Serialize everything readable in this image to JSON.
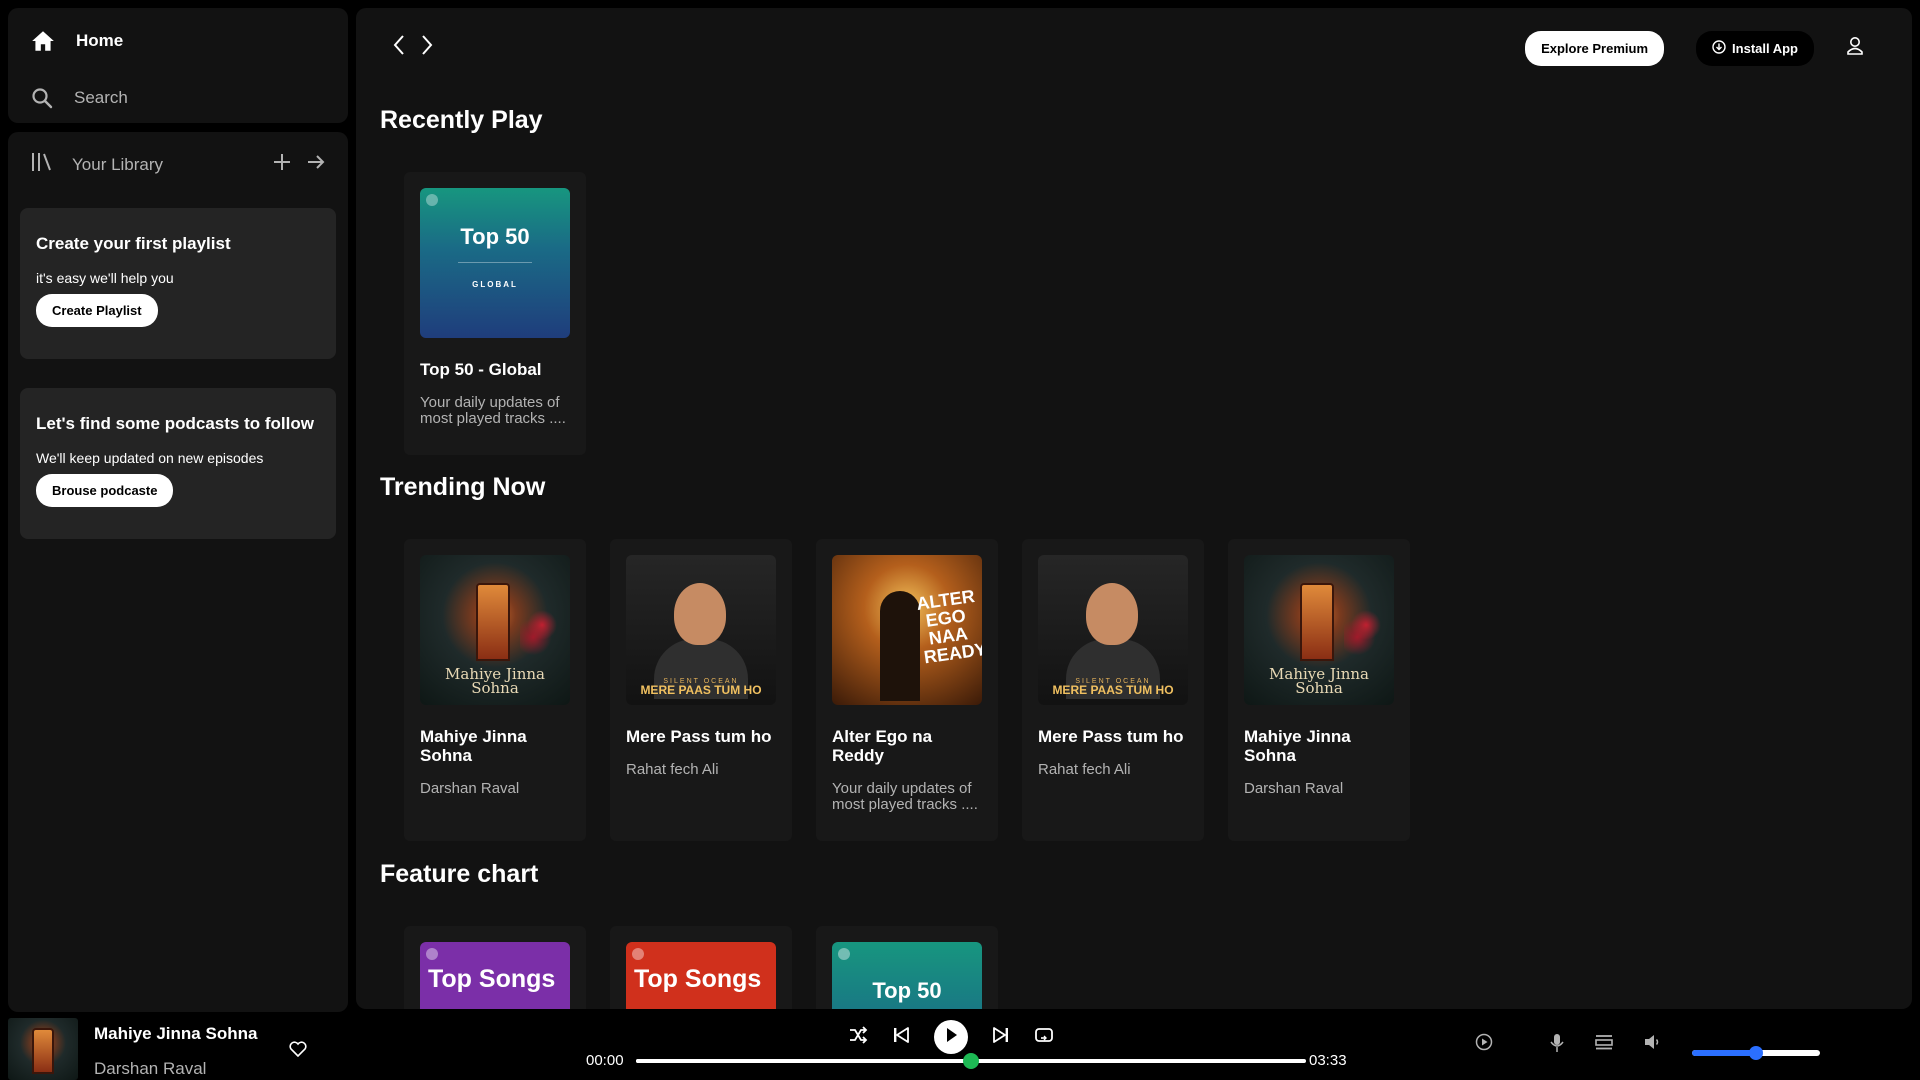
{
  "sidebar": {
    "home_label": "Home",
    "search_label": "Search",
    "library_label": "Your Library",
    "playlist_card": {
      "title": "Create your first playlist",
      "text": "it's easy we'll help you",
      "button": "Create Playlist"
    },
    "podcast_card": {
      "title": "Let's find some podcasts to follow",
      "text": "We'll keep updated on new episodes",
      "button": "Brouse podcaste"
    }
  },
  "header": {
    "premium_button": "Explore Premium",
    "install_button": "Install App"
  },
  "sections": {
    "recent": {
      "title": "Recently Play",
      "cards": [
        {
          "title": "Top 50 - Global",
          "subtitle": "Your daily updates of most played tracks ....",
          "cover_text": "Top 50",
          "cover_sub": "GLOBAL"
        }
      ]
    },
    "trending": {
      "title": "Trending Now",
      "cards": [
        {
          "title": "Mahiye Jinna Sohna",
          "subtitle": "Darshan Raval",
          "cover_text": "Mahiye Jinna Sohna"
        },
        {
          "title": "Mere Pass tum ho",
          "subtitle": "Rahat fech Ali",
          "cover_caption": "SILENT OCEAN",
          "cover_text": "MERE PAAS TUM HO"
        },
        {
          "title": "Alter Ego na Reddy",
          "subtitle": "Your daily updates of most played tracks ....",
          "cover_text": "ALTER EGO NAA READY"
        },
        {
          "title": "Mere Pass tum ho",
          "subtitle": "Rahat fech Ali",
          "cover_caption": "SILENT OCEAN",
          "cover_text": "MERE PAAS TUM HO"
        },
        {
          "title": "Mahiye Jinna Sohna",
          "subtitle": "Darshan Raval",
          "cover_text": "Mahiye Jinna Sohna"
        }
      ]
    },
    "feature": {
      "title": "Feature chart",
      "cards": [
        {
          "cover_text": "Top Songs"
        },
        {
          "cover_text": "Top Songs"
        },
        {
          "cover_text": "Top 50"
        }
      ]
    }
  },
  "player": {
    "track_title": "Mahiye Jinna Sohna",
    "artist": "Darshan Raval",
    "current_time": "00:00",
    "duration": "03:33",
    "progress_fraction": 0.5,
    "volume_fraction": 0.5
  },
  "colors": {
    "accent_green": "#1db954",
    "volume_blue": "#2b6fff",
    "panel": "#121212",
    "card": "#181818"
  }
}
